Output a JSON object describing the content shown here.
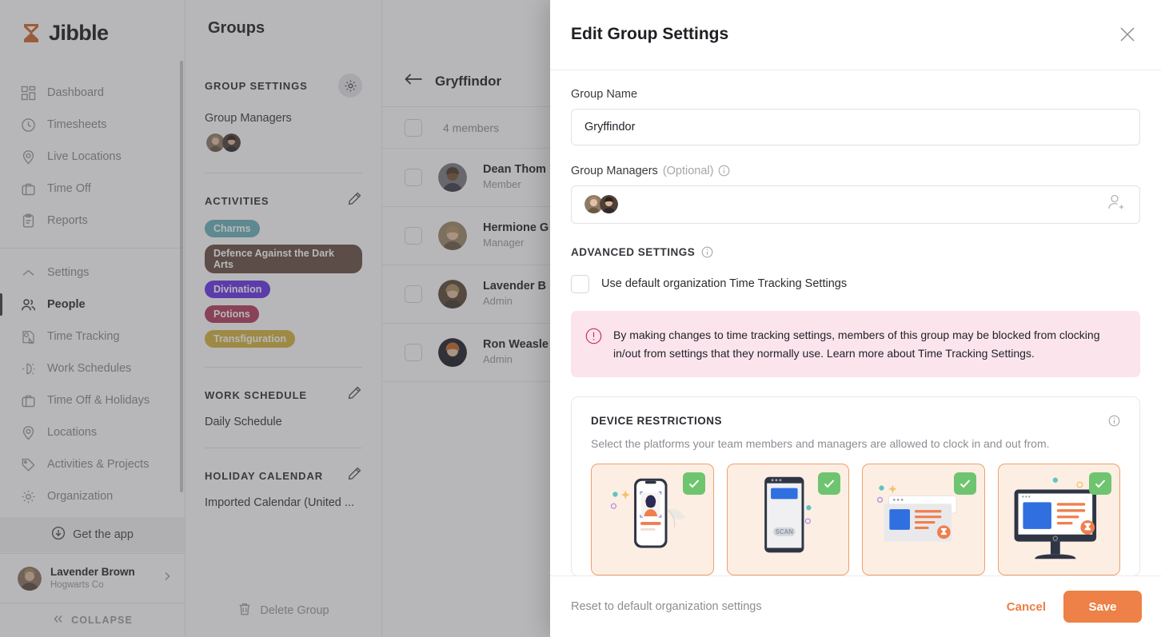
{
  "brand": {
    "name": "Jibble",
    "accent": "#cf6a2e",
    "primary": "#ee8147"
  },
  "sidebar": {
    "items": [
      {
        "label": "Dashboard",
        "icon": "dashboard-icon",
        "active": false
      },
      {
        "label": "Timesheets",
        "icon": "clock-icon",
        "active": false
      },
      {
        "label": "Live Locations",
        "icon": "pin-icon",
        "active": false
      },
      {
        "label": "Time Off",
        "icon": "briefcase-icon",
        "active": false
      },
      {
        "label": "Reports",
        "icon": "clipboard-icon",
        "active": false
      }
    ],
    "items2": [
      {
        "label": "Settings",
        "icon": "chevron-up-icon",
        "active": false
      },
      {
        "label": "People",
        "icon": "people-icon",
        "active": true
      },
      {
        "label": "Time Tracking",
        "icon": "time-tracking-icon",
        "active": false
      },
      {
        "label": "Work Schedules",
        "icon": "work-schedule-icon",
        "active": false
      },
      {
        "label": "Time Off & Holidays",
        "icon": "briefcase-icon",
        "active": false
      },
      {
        "label": "Locations",
        "icon": "pin-icon",
        "active": false
      },
      {
        "label": "Activities & Projects",
        "icon": "tag-icon",
        "active": false
      },
      {
        "label": "Organization",
        "icon": "gear-icon",
        "active": false
      }
    ],
    "get_the_app": "Get the app",
    "user": {
      "name": "Lavender Brown",
      "org": "Hogwarts Co"
    },
    "collapse": "COLLAPSE"
  },
  "groups_panel": {
    "page_title": "Groups",
    "group_settings_heading": "GROUP SETTINGS",
    "group_managers_label": "Group Managers",
    "activities_heading": "ACTIVITIES",
    "activities": [
      {
        "label": "Charms",
        "color": "#6bb3bb"
      },
      {
        "label": "Defence Against the Dark Arts",
        "color": "#6a4f43"
      },
      {
        "label": "Divination",
        "color": "#6633e6"
      },
      {
        "label": "Potions",
        "color": "#b23d5d"
      },
      {
        "label": "Transfiguration",
        "color": "#d6b43c"
      }
    ],
    "work_schedule_heading": "WORK SCHEDULE",
    "work_schedule_value": "Daily Schedule",
    "holiday_calendar_heading": "HOLIDAY CALENDAR",
    "holiday_calendar_value": "Imported Calendar (United ...",
    "delete_group": "Delete Group"
  },
  "members_panel": {
    "group_name": "Gryffindor",
    "count_label": "4 members",
    "rows": [
      {
        "name": "Dean Thom",
        "role": "Member"
      },
      {
        "name": "Hermione G",
        "role": "Manager"
      },
      {
        "name": "Lavender B",
        "role": "Admin"
      },
      {
        "name": "Ron Weasle",
        "role": "Admin"
      }
    ]
  },
  "modal": {
    "title": "Edit Group Settings",
    "group_name_label": "Group Name",
    "group_name_value": "Gryffindor",
    "group_managers_label": "Group Managers",
    "group_managers_optional": "(Optional)",
    "advanced_settings_heading": "ADVANCED SETTINGS",
    "use_default_checkbox_label": "Use default organization Time Tracking Settings",
    "use_default_checked": false,
    "warning_text": "By making changes to time tracking settings, members of this group may be blocked from clocking in/out from settings that they normally use. Learn more about Time Tracking Settings.",
    "device_restrictions_heading": "DEVICE RESTRICTIONS",
    "device_restrictions_sub": "Select the platforms your team members and managers are allowed to clock in and out from.",
    "devices": [
      {
        "name": "mobile-selfie",
        "selected": true
      },
      {
        "name": "kiosk-scan",
        "selected": true
      },
      {
        "name": "web-browser",
        "selected": true
      },
      {
        "name": "desktop-app",
        "selected": true
      }
    ],
    "reset_label": "Reset to default organization settings",
    "cancel_label": "Cancel",
    "save_label": "Save"
  }
}
